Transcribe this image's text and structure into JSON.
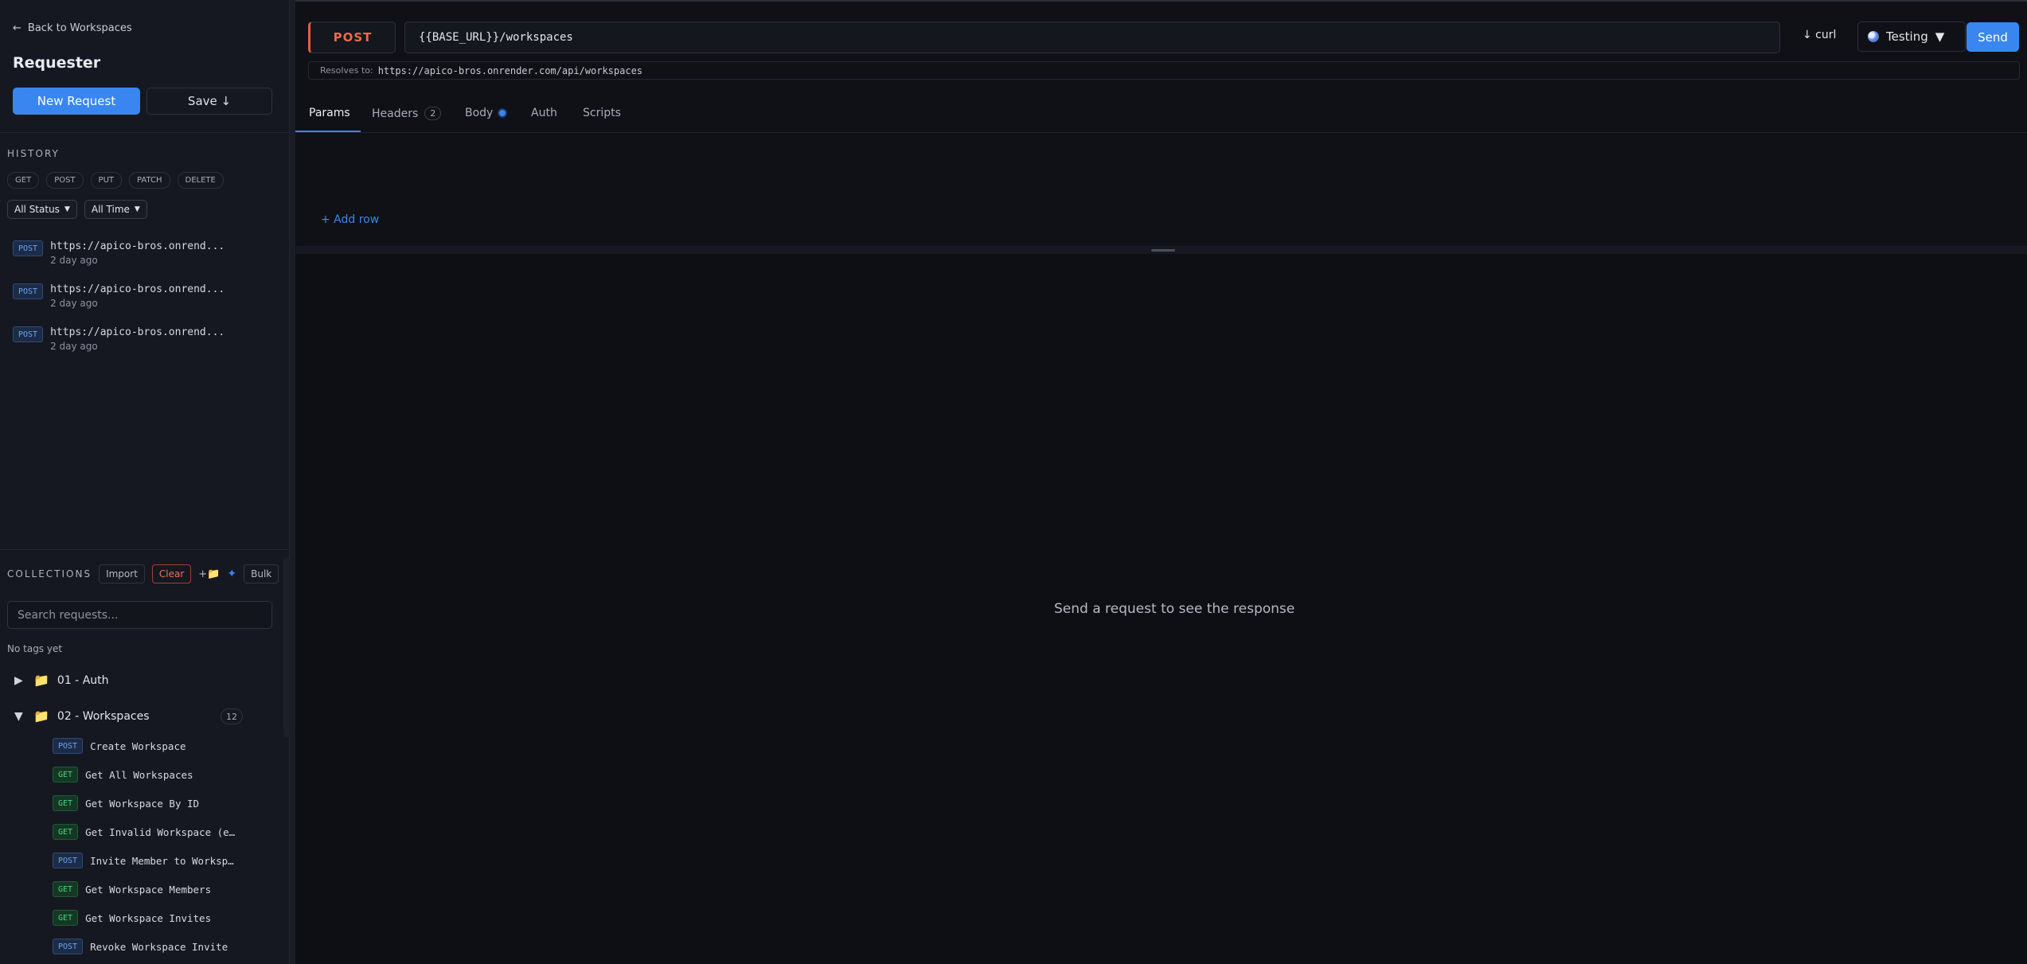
{
  "sidebar": {
    "back_label": "Back to Workspaces",
    "title": "Requester",
    "new_request_label": "New Request",
    "save_label": "Save ↓",
    "history": {
      "label": "HISTORY",
      "method_filters": [
        "GET",
        "POST",
        "PUT",
        "PATCH",
        "DELETE"
      ],
      "status_filter": "All Status",
      "time_filter": "All Time",
      "items": [
        {
          "method": "POST",
          "url": "https://apico-bros.onrend...",
          "time": "2 day ago"
        },
        {
          "method": "POST",
          "url": "https://apico-bros.onrend...",
          "time": "2 day ago"
        },
        {
          "method": "POST",
          "url": "https://apico-bros.onrend...",
          "time": "2 day ago"
        }
      ]
    },
    "collections": {
      "label": "COLLECTIONS",
      "import_label": "Import",
      "clear_label": "Clear",
      "add_folder_label": "+📁",
      "ai_label": "✦",
      "bulk_label": "Bulk",
      "search_placeholder": "Search requests...",
      "no_tags": "No tags yet",
      "folders": [
        {
          "name": "01 - Auth",
          "expanded": false
        },
        {
          "name": "02 - Workspaces",
          "expanded": true,
          "count": "12"
        }
      ],
      "requests": [
        {
          "method": "POST",
          "name": "Create Workspace"
        },
        {
          "method": "GET",
          "name": "Get All Workspaces"
        },
        {
          "method": "GET",
          "name": "Get Workspace By ID"
        },
        {
          "method": "GET",
          "name": "Get Invalid Workspace (e…"
        },
        {
          "method": "POST",
          "name": "Invite Member to Worksp…"
        },
        {
          "method": "GET",
          "name": "Get Workspace Members"
        },
        {
          "method": "GET",
          "name": "Get Workspace Invites"
        },
        {
          "method": "POST",
          "name": "Revoke Workspace Invite"
        }
      ]
    }
  },
  "request": {
    "method": "POST",
    "url": "{{BASE_URL}}/workspaces",
    "curl_label": "↓ curl",
    "environment": "Testing",
    "send_label": "Send",
    "resolves_label": "Resolves to:",
    "resolves_value": "https://apico-bros.onrender.com/api/workspaces"
  },
  "tabs": [
    {
      "label": "Params"
    },
    {
      "label": "Headers",
      "count": "2"
    },
    {
      "label": "Body"
    },
    {
      "label": "Auth"
    },
    {
      "label": "Scripts"
    }
  ],
  "params": {
    "add_row_label": "+ Add row"
  },
  "response": {
    "empty_message": "Send a request to see the response"
  },
  "colors": {
    "accent": "#3a86f0",
    "post": "#ee6a45",
    "get": "#4fd07e"
  }
}
